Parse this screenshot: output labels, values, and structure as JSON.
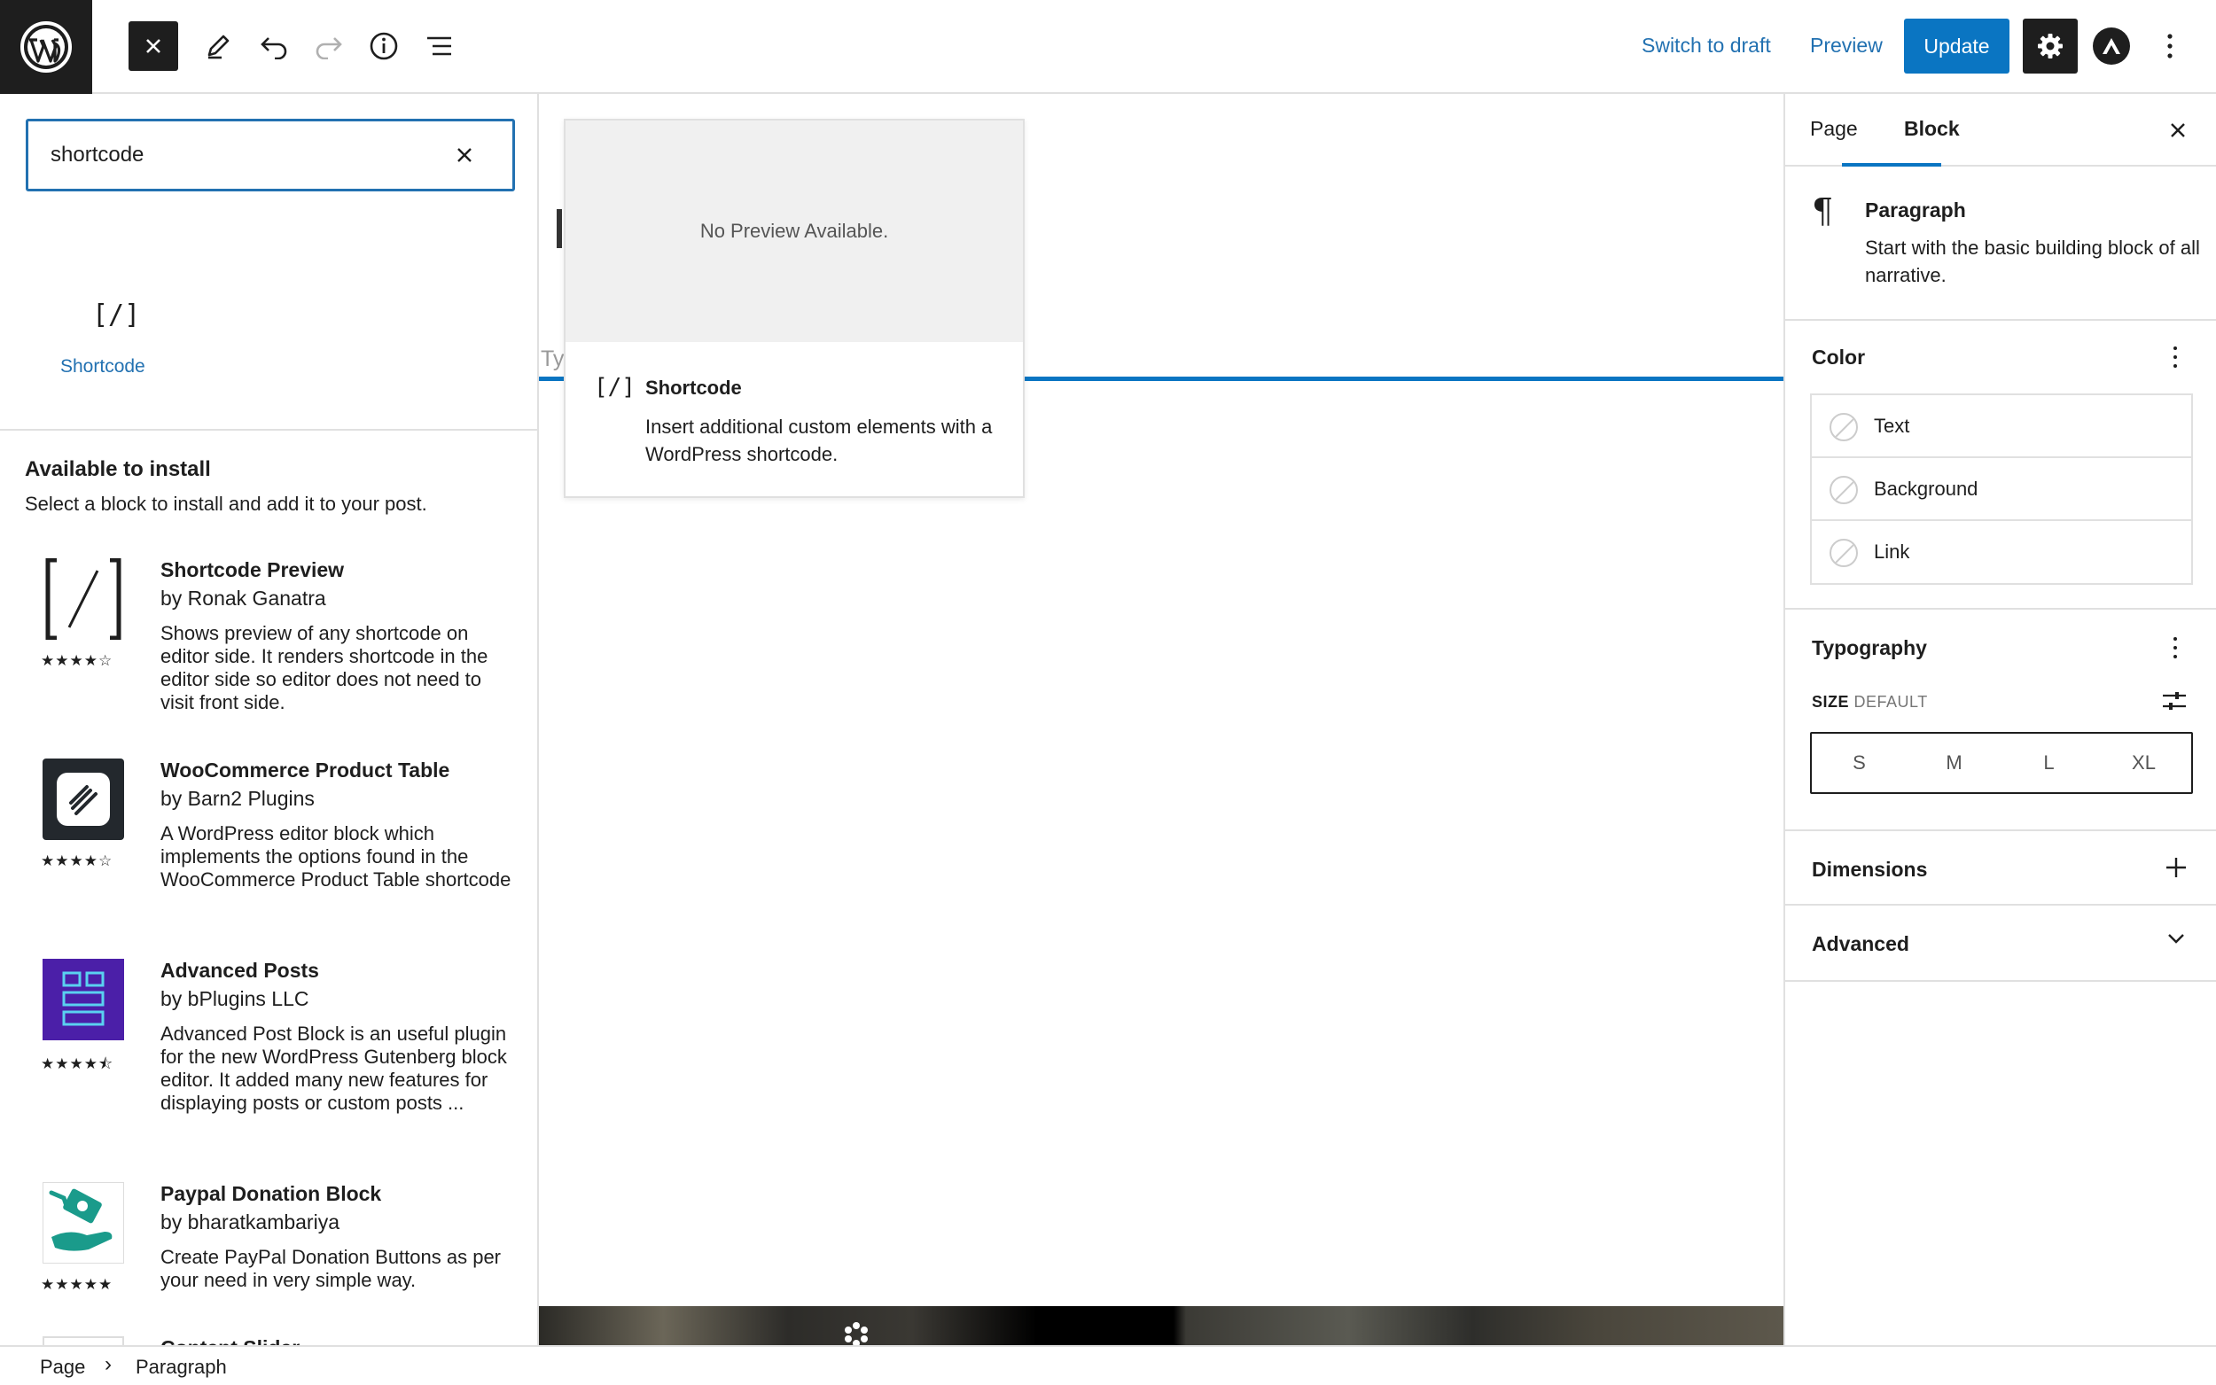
{
  "topbar": {
    "switch_to_draft": "Switch to draft",
    "preview": "Preview",
    "update": "Update",
    "icons": [
      "wordpress-logo",
      "close-icon",
      "pencil-icon",
      "undo-icon",
      "redo-icon",
      "info-icon",
      "list-view-icon",
      "gear-icon",
      "astra-icon",
      "more-vertical-icon"
    ]
  },
  "inserter": {
    "search_value": "shortcode",
    "result": {
      "glyph": "[/]",
      "label": "Shortcode"
    },
    "available_title": "Available to install",
    "available_sub": "Select a block to install and add it to your post.",
    "plugins": [
      {
        "name": "Shortcode Preview",
        "author": "by Ronak Ganatra",
        "description": "Shows preview of any shortcode on editor side. It renders shortcode in the editor side so editor does not need to visit front side.",
        "stars": "★★★★☆",
        "rating": 4
      },
      {
        "name": "WooCommerce Product Table",
        "author": "by Barn2 Plugins",
        "description": "A WordPress editor block which implements the options found in the WooCommerce Product Table shortcode",
        "stars": "★★★★☆",
        "rating": 4
      },
      {
        "name": "Advanced Posts",
        "author": "by bPlugins LLC",
        "description": "Advanced Post Block is an useful plugin for the new WordPress Gutenberg block editor. It added many new features for displaying posts or custom posts ...",
        "stars": "★★★★⯪",
        "rating": 4.5
      },
      {
        "name": "Paypal Donation Block",
        "author": "by bharatkambariya",
        "description": "Create PayPal Donation Buttons as per your need in very simple way.",
        "stars": "★★★★★",
        "rating": 5
      }
    ],
    "partial_next_plugin": "Content Slider"
  },
  "canvas": {
    "typed_ghost": "Ty",
    "preview_card": {
      "no_preview": "No Preview Available.",
      "glyph": "[/]",
      "title": "Shortcode",
      "description": "Insert additional custom elements with a WordPress shortcode."
    }
  },
  "sidebar": {
    "tabs": [
      "Page",
      "Block"
    ],
    "active_tab": "Block",
    "block_card": {
      "title": "Paragraph",
      "description": "Start with the basic building block of all narrative."
    },
    "color": {
      "heading": "Color",
      "items": [
        "Text",
        "Background",
        "Link"
      ]
    },
    "typography": {
      "heading": "Typography",
      "size_label": "SIZE",
      "size_value": "DEFAULT",
      "sizes": [
        "S",
        "M",
        "L",
        "XL"
      ]
    },
    "dimensions": "Dimensions",
    "advanced": "Advanced"
  },
  "footer": {
    "crumbs": [
      "Page",
      "Paragraph"
    ],
    "separator": "›"
  },
  "colors": {
    "accent": "#0a75c2",
    "dark": "#1e1e1e",
    "border": "#e0e0e0"
  }
}
